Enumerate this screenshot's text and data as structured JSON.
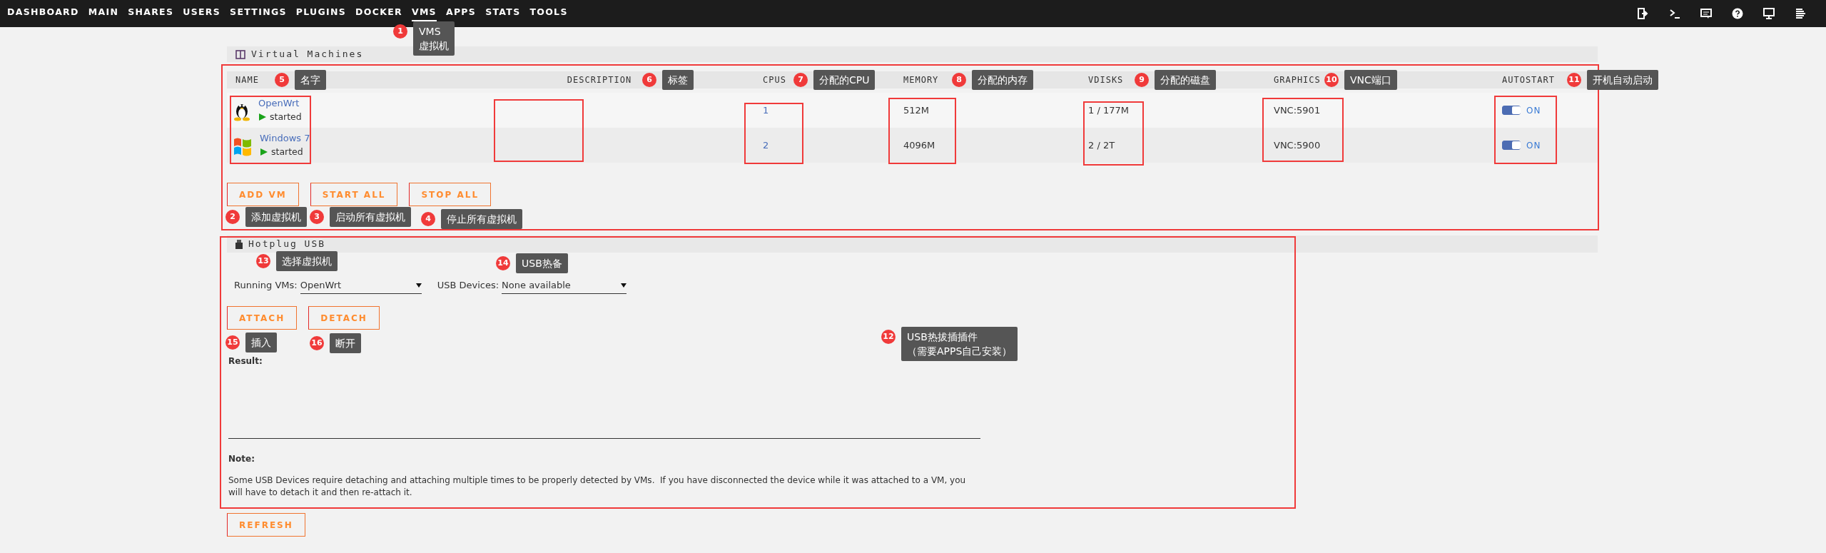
{
  "nav": {
    "items": [
      {
        "label": "DASHBOARD",
        "selected": false
      },
      {
        "label": "MAIN",
        "selected": false
      },
      {
        "label": "SHARES",
        "selected": false
      },
      {
        "label": "USERS",
        "selected": false
      },
      {
        "label": "SETTINGS",
        "selected": false
      },
      {
        "label": "PLUGINS",
        "selected": false
      },
      {
        "label": "DOCKER",
        "selected": false
      },
      {
        "label": "VMS",
        "selected": true
      },
      {
        "label": "APPS",
        "selected": false
      },
      {
        "label": "STATS",
        "selected": false
      },
      {
        "label": "TOOLS",
        "selected": false
      }
    ]
  },
  "vms_section": {
    "title": "Virtual Machines",
    "columns": [
      "NAME",
      "DESCRIPTION",
      "CPUS",
      "MEMORY",
      "VDISKS",
      "GRAPHICS",
      "AUTOSTART"
    ],
    "rows": [
      {
        "kind": "linux",
        "name": "OpenWrt",
        "status": "started",
        "cpus": "1",
        "memory": "512M",
        "vdisks": "1 / 177M",
        "graphics": "VNC:5901",
        "autostart": true,
        "autostart_label": "ON"
      },
      {
        "kind": "windows",
        "name": "Windows 7",
        "status": "started",
        "cpus": "2",
        "memory": "4096M",
        "vdisks": "2 / 2T",
        "graphics": "VNC:5900",
        "autostart": true,
        "autostart_label": "ON"
      }
    ],
    "buttons": [
      "ADD VM",
      "START ALL",
      "STOP ALL"
    ]
  },
  "hotplug": {
    "title": "Hotplug USB",
    "running_vms": {
      "label": "Running VMs:",
      "value": "OpenWrt"
    },
    "usb_devices": {
      "label": "USB Devices:",
      "value": "None available"
    },
    "buttons": [
      "ATTACH",
      "DETACH"
    ],
    "result_label": "Result:",
    "note_title": "Note:",
    "note": "Some USB Devices require detaching and attaching multiple times to be properly detected by VMs.  If you have disconnected the device while it was attached to a VM, you will have to detach it and then re-attach it."
  },
  "refresh_button": "REFRESH",
  "annotations": [
    {
      "number": "1",
      "lines": [
        "VMS",
        "虚拟机"
      ]
    },
    {
      "number": "2",
      "lines": [
        "添加虚拟机"
      ]
    },
    {
      "number": "3",
      "lines": [
        "启动所有虚拟机"
      ]
    },
    {
      "number": "4",
      "lines": [
        "停止所有虚拟机"
      ]
    },
    {
      "number": "5",
      "lines": [
        "名字"
      ]
    },
    {
      "number": "6",
      "lines": [
        "标签"
      ]
    },
    {
      "number": "7",
      "lines": [
        "分配的CPU"
      ]
    },
    {
      "number": "8",
      "lines": [
        "分配的内存"
      ]
    },
    {
      "number": "9",
      "lines": [
        "分配的磁盘"
      ]
    },
    {
      "number": "10",
      "lines": [
        "VNC端口"
      ]
    },
    {
      "number": "11",
      "lines": [
        "开机自动启动"
      ]
    },
    {
      "number": "12",
      "lines": [
        "USB热拔插插件",
        "（需要APPS自己安装）"
      ]
    },
    {
      "number": "13",
      "lines": [
        "选择虚拟机"
      ]
    },
    {
      "number": "14",
      "lines": [
        "USB热备"
      ]
    },
    {
      "number": "15",
      "lines": [
        "插入"
      ]
    },
    {
      "number": "16",
      "lines": [
        "断开"
      ]
    }
  ]
}
